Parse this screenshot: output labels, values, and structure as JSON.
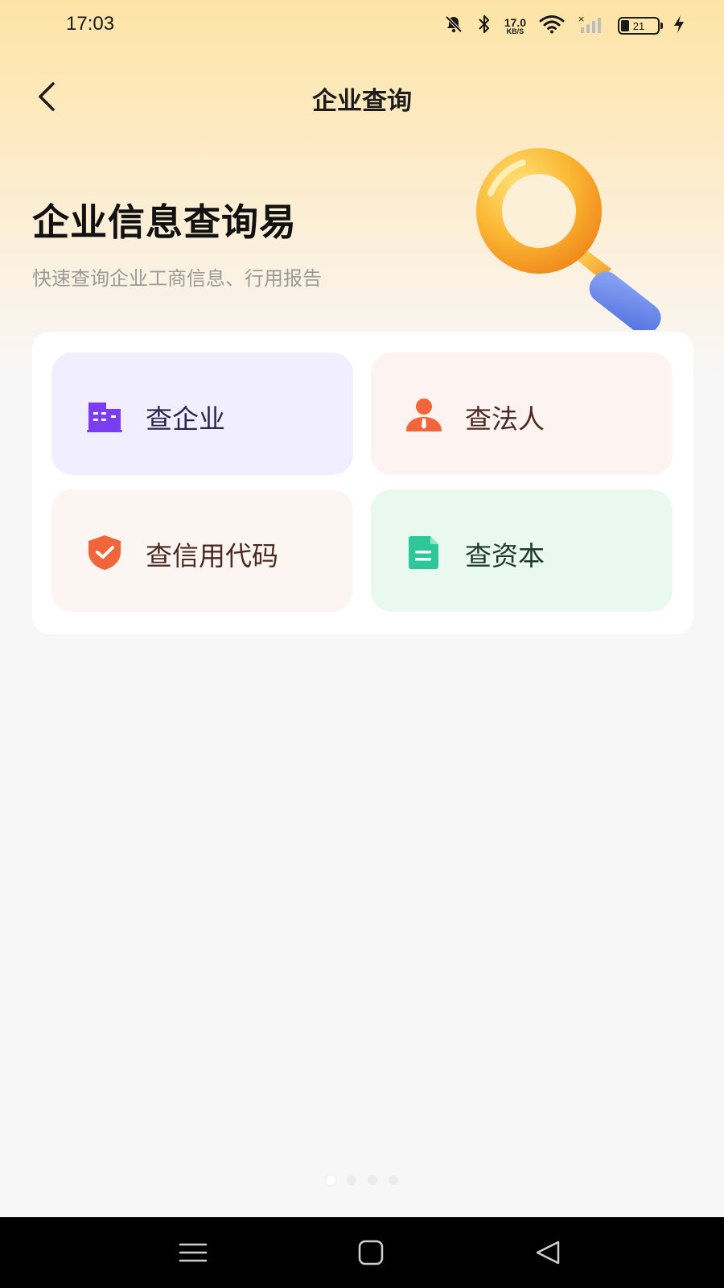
{
  "status_bar": {
    "time": "17:03",
    "net_speed_value": "17.0",
    "net_speed_unit": "KB/S",
    "battery_level": "21",
    "icons": [
      "mute-bell-icon",
      "bluetooth-icon",
      "wifi-icon",
      "signal-no-sim-icon",
      "battery-icon",
      "charging-icon"
    ]
  },
  "header": {
    "back_icon": "chevron-left-icon",
    "title": "企业查询"
  },
  "hero": {
    "title": "企业信息查询易",
    "subtitle": "快速查询企业工商信息、行用报告",
    "illustration": "magnifier-illustration"
  },
  "menu": {
    "items": [
      {
        "label": "查企业",
        "icon": "building-icon",
        "icon_color": "#7b3df0",
        "bg_color": "#f1efff"
      },
      {
        "label": "查法人",
        "icon": "person-icon",
        "icon_color": "#f0663a",
        "bg_color": "#fdf4f1"
      },
      {
        "label": "查信用代码",
        "icon": "shield-check-icon",
        "icon_color": "#f0663a",
        "bg_color": "#fdf5f1"
      },
      {
        "label": "查资本",
        "icon": "document-icon",
        "icon_color": "#2ec79a",
        "bg_color": "#eaf9f0"
      }
    ]
  },
  "pager": {
    "count": 4,
    "active_index": 0
  },
  "system_nav": {
    "buttons": [
      "menu-icon",
      "home-icon",
      "back-triangle-icon"
    ]
  }
}
